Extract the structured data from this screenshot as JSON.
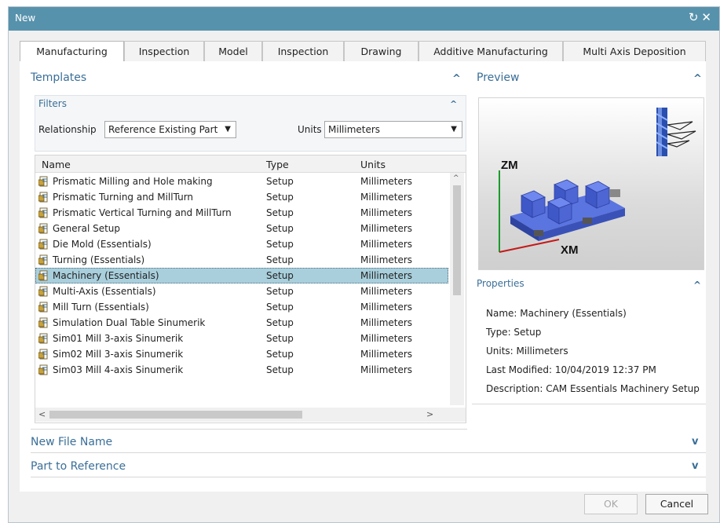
{
  "window": {
    "title": "New",
    "refresh_glyph": "↻",
    "close_glyph": "✕"
  },
  "tabs": [
    {
      "label": "Manufacturing",
      "active": true
    },
    {
      "label": "Inspection",
      "active": false
    },
    {
      "label": "Model",
      "active": false
    },
    {
      "label": "Inspection",
      "active": false
    },
    {
      "label": "Drawing",
      "active": false
    },
    {
      "label": "Additive Manufacturing",
      "active": false
    },
    {
      "label": "Multi Axis Deposition",
      "active": false
    }
  ],
  "templates": {
    "title": "Templates",
    "filters": {
      "title": "Filters",
      "relationship_label": "Relationship",
      "relationship_value": "Reference Existing Part",
      "units_label": "Units",
      "units_value": "Millimeters"
    },
    "columns": [
      "Name",
      "Type",
      "Units"
    ],
    "rows": [
      {
        "name": "Prismatic Milling and Hole making",
        "type": "Setup",
        "units": "Millimeters"
      },
      {
        "name": "Prismatic Turning and MillTurn",
        "type": "Setup",
        "units": "Millimeters"
      },
      {
        "name": "Prismatic Vertical Turning and MillTurn",
        "type": "Setup",
        "units": "Millimeters"
      },
      {
        "name": "General Setup",
        "type": "Setup",
        "units": "Millimeters"
      },
      {
        "name": "Die Mold (Essentials)",
        "type": "Setup",
        "units": "Millimeters"
      },
      {
        "name": "Turning (Essentials)",
        "type": "Setup",
        "units": "Millimeters"
      },
      {
        "name": "Machinery (Essentials)",
        "type": "Setup",
        "units": "Millimeters"
      },
      {
        "name": "Multi-Axis (Essentials)",
        "type": "Setup",
        "units": "Millimeters"
      },
      {
        "name": "Mill Turn (Essentials)",
        "type": "Setup",
        "units": "Millimeters"
      },
      {
        "name": "Simulation Dual Table Sinumerik",
        "type": "Setup",
        "units": "Millimeters"
      },
      {
        "name": "Sim01 Mill 3-axis Sinumerik",
        "type": "Setup",
        "units": "Millimeters"
      },
      {
        "name": "Sim02 Mill 3-axis Sinumerik",
        "type": "Setup",
        "units": "Millimeters"
      },
      {
        "name": "Sim03 Mill 4-axis Sinumerik",
        "type": "Setup",
        "units": "Millimeters"
      }
    ],
    "selected_index": 6
  },
  "preview": {
    "title": "Preview",
    "axis_z": "ZM",
    "axis_x": "XM"
  },
  "properties": {
    "title": "Properties",
    "name": "Name: Machinery (Essentials)",
    "type": "Type: Setup",
    "units": "Units: Millimeters",
    "last_modified": "Last Modified: 10/04/2019 12:37 PM",
    "description": "Description: CAM Essentials Machinery Setup"
  },
  "sections": {
    "new_file_name": "New File Name",
    "part_to_reference": "Part to Reference"
  },
  "buttons": {
    "ok": "OK",
    "cancel": "Cancel"
  },
  "colors": {
    "titlebar": "#5792ac",
    "accent": "#3a6f98",
    "selection": "#a9cfdc"
  }
}
